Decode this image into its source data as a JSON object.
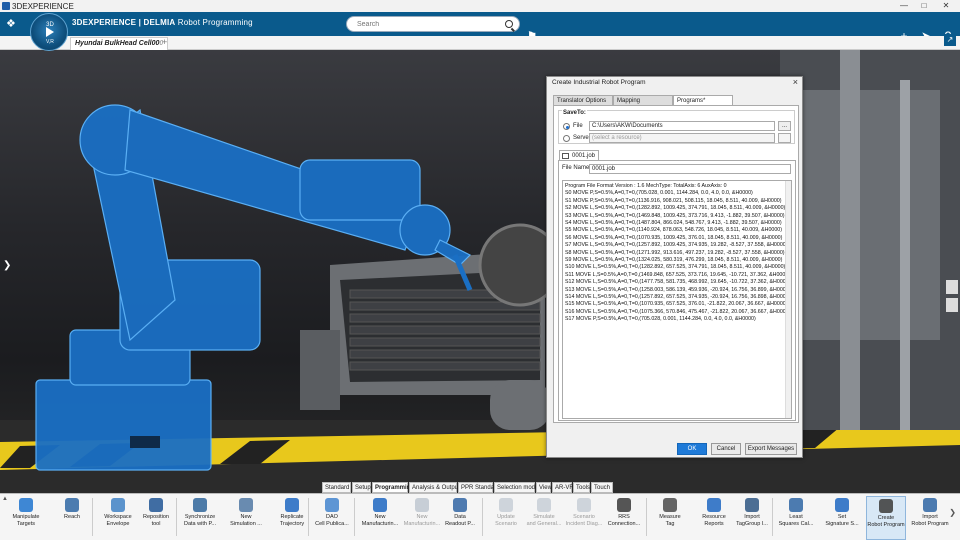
{
  "window": {
    "title": "3DEXPERIENCE"
  },
  "app": {
    "brand_bold": "3DEXPERIENCE | DELMIA",
    "brand_rest": " Robot Programming",
    "compass_top": "3D",
    "compass_bottom": "V,R"
  },
  "search": {
    "placeholder": "Search"
  },
  "tab": {
    "label": "Hyundai BulkHead Cell00",
    "label_fade": "0"
  },
  "dialog": {
    "title": "Create Industrial Robot Program",
    "tabs": [
      "Translator Options",
      "Mapping",
      "Programs*"
    ],
    "save_to_label": "SaveTo:",
    "file_label": "File",
    "file_path": "C:\\Users\\AKW\\Documents",
    "browse": "...",
    "server_label": "Server",
    "server_placeholder": "(select a resource)",
    "job_tab": "0001.job",
    "file_name_label": "File Name:",
    "file_name": "0001.job",
    "program_lines": [
      "Program File Format Version : 1.6 MechType:  TotalAxis: 6 AuxAxis: 0",
      "S0   MOVE P,S=0.5%,A=0,T=0,(705.028, 0.001, 1144.284, 0.0, 4.0, 0.0, &H0000)",
      "S1   MOVE P,S=0.5%,A=0,T=0,(1136.916, 908.021, 508.115, 18.045, 8.511, 40.009, &H0000)",
      "S2   MOVE L,S=0.5%,A=0,T=0,(1282.892, 1009.425, 374.791, 18.045, 8.511, 40.009, &H0000)",
      "S3   MOVE L,S=0.5%,A=0,T=0,(1469.848, 1009.425, 373.716, 9.413, -1.882, 39.507, &H0000)",
      "S4   MOVE L,S=0.5%,A=0,T=0,(1487.804, 866.024, 548.767, 9.413, -1.882, 39.507, &H0000)",
      "S5   MOVE L,S=0.5%,A=0,T=0,(1140.924, 878.063, 548.726, 18.045, 8.511, 40.009, &H0000)",
      "S6   MOVE L,S=0.5%,A=0,T=0,(1070.935, 1009.425, 376.01, 18.045, 8.511, 40.009, &H0000)",
      "S7   MOVE L,S=0.5%,A=0,T=0,(1257.892, 1009.425, 374.935, 19.282, -8.527, 37.558, &H0000)",
      "S8   MOVE L,S=0.5%,A=0,T=0,(1271.992, 913.616, 497.237, 19.282, -8.527, 37.558, &H0000)",
      "S9   MOVE L,S=0.5%,A=0,T=0,(1324.025, 580.319, 476.299, 18.045, 8.511, 40.009, &H0000)",
      "S10   MOVE L,S=0.5%,A=0,T=0,(1282.892, 657.525, 374.791, 18.045, 8.511, 40.009, &H0000)",
      "S11   MOVE L,S=0.5%,A=0,T=0,(1469.848, 657.525, 373.716, 19.645, -10.721, 37.362, &H0000)",
      "S12   MOVE L,S=0.5%,A=0,T=0,(1477.758, 581.735, 468.992, 19.645, -10.722, 37.362, &H0000)",
      "S13   MOVE L,S=0.5%,A=0,T=0,(1258.003, 586.139, 459.936, -20.924, 16.756, 36.899, &H0000)",
      "S14   MOVE L,S=0.5%,A=0,T=0,(1257.892, 657.525, 374.935, -20.924, 16.756, 36.898, &H0000)",
      "S15   MOVE L,S=0.5%,A=0,T=0,(1070.935, 657.525, 376.01, -21.822, 20.067, 36.667, &H0000)",
      "S16   MOVE L,S=0.5%,A=0,T=0,(1075.366, 570.846, 475.467, -21.822, 20.067, 36.667, &H0000)",
      "S17   MOVE P,S=0.5%,A=0,T=0,(705.028, 0.001, 1144.284, 0.0, 4.0, 0.0, &H0000)"
    ],
    "ok": "OK",
    "cancel": "Cancel",
    "export": "Export Messages"
  },
  "ribbon_tabs": [
    "Standard",
    "Setup",
    "Programming",
    "Analysis & Output",
    "PPR Standard",
    "Selection mode",
    "View",
    "AR-VR",
    "Tools",
    "Touch"
  ],
  "tools": [
    {
      "l1": "Manipulate",
      "l2": "Targets"
    },
    {
      "l1": "Reach",
      "l2": ""
    },
    {
      "l1": "Workspace",
      "l2": "Envelope"
    },
    {
      "l1": "Reposition",
      "l2": "tool"
    },
    {
      "l1": "Synchronize",
      "l2": "Data with P..."
    },
    {
      "l1": "New",
      "l2": "Simulation ..."
    },
    {
      "l1": "Replicate",
      "l2": "Trajectory"
    },
    {
      "l1": "DAO",
      "l2": "Cell Publica..."
    },
    {
      "l1": "New",
      "l2": "Manufacturin..."
    },
    {
      "l1": "New",
      "l2": "Manufacturin..."
    },
    {
      "l1": "Data",
      "l2": "Readout P..."
    },
    {
      "l1": "Update",
      "l2": "Scenario"
    },
    {
      "l1": "Simulate",
      "l2": "and General..."
    },
    {
      "l1": "Scenario",
      "l2": "Incident Diag..."
    },
    {
      "l1": "RRS",
      "l2": "Connection..."
    },
    {
      "l1": "Measure",
      "l2": "Tag"
    },
    {
      "l1": "Resource",
      "l2": "Reports"
    },
    {
      "l1": "Import",
      "l2": "TagGroup I..."
    },
    {
      "l1": "Least",
      "l2": "Squares Cal..."
    },
    {
      "l1": "Set",
      "l2": "Signature S..."
    },
    {
      "l1": "Create",
      "l2": "Robot Program"
    },
    {
      "l1": "Import",
      "l2": "Robot Program"
    }
  ],
  "colors": {
    "accent": "#0a5a8c",
    "robot": "#1a6fc4",
    "ok_button": "#1e7ad8"
  }
}
